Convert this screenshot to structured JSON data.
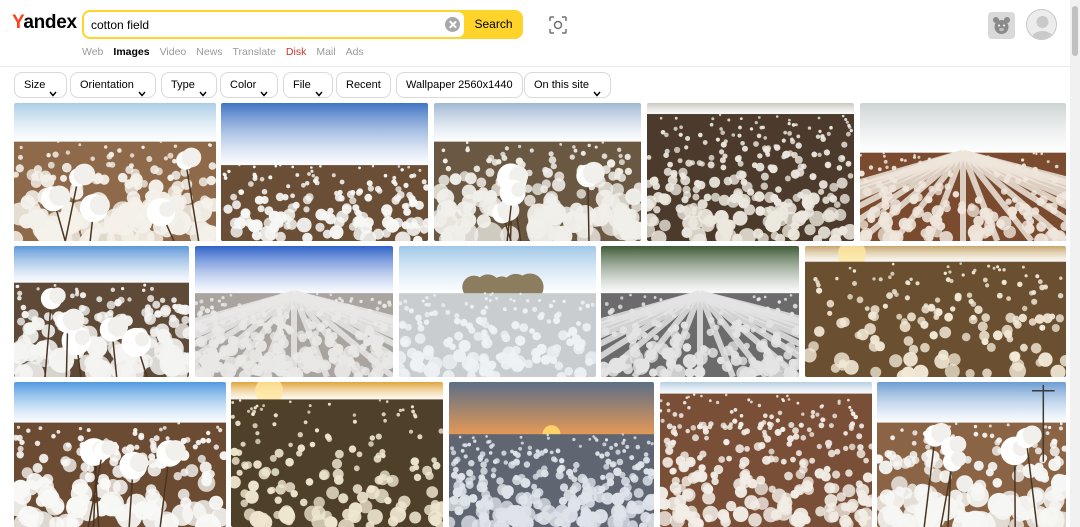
{
  "header": {
    "logo_y": "Y",
    "logo_rest": "andex",
    "search_value": "cotton field",
    "search_button": "Search",
    "services": [
      {
        "label": "Web",
        "state": "normal"
      },
      {
        "label": "Images",
        "state": "active"
      },
      {
        "label": "Video",
        "state": "normal"
      },
      {
        "label": "News",
        "state": "normal"
      },
      {
        "label": "Translate",
        "state": "normal"
      },
      {
        "label": "Disk",
        "state": "disk"
      },
      {
        "label": "Mail",
        "state": "normal"
      },
      {
        "label": "Ads",
        "state": "normal"
      }
    ],
    "icons": {
      "camera": "camera-search-icon",
      "bear": "bear-icon",
      "avatar": "avatar-icon",
      "clear": "clear-icon"
    }
  },
  "filters": [
    {
      "label": "Size",
      "dropdown": true
    },
    {
      "label": "Orientation",
      "dropdown": true
    },
    {
      "label": "Type",
      "dropdown": true
    },
    {
      "label": "Color",
      "dropdown": true
    },
    {
      "label": "File",
      "dropdown": true
    },
    {
      "label": "Recent",
      "dropdown": false
    },
    {
      "label": "Wallpaper 2560x1440",
      "dropdown": false
    },
    {
      "label": "On this site",
      "dropdown": true
    }
  ],
  "colors": {
    "accent": "#fed42b",
    "logo_red": "#fc3f1d",
    "disk_red": "#c8352e"
  },
  "images": [
    {
      "name": "cotton-closeup-blue-sky",
      "sky": "#aacde6",
      "ground": "#8f6a4a",
      "cotton": "#f4f1ea",
      "style": "closeup"
    },
    {
      "name": "cotton-rows-bright-sky",
      "sky": "#3f74c4",
      "ground": "#6a4f36",
      "cotton": "#f7f7f5",
      "style": "diagonal"
    },
    {
      "name": "cotton-bolls-pale-sky",
      "sky": "#9fb8d2",
      "ground": "#6b5842",
      "cotton": "#f1efea",
      "style": "closeup"
    },
    {
      "name": "cotton-dense-field",
      "sky": "#c9c7c2",
      "ground": "#4c3b2c",
      "cotton": "#ece8df",
      "style": "dense"
    },
    {
      "name": "cotton-row-hazy",
      "sky": "#cdd3d4",
      "ground": "#7a4b2f",
      "cotton": "#efe6dc",
      "style": "perspective"
    },
    {
      "name": "cotton-branch-cloudy",
      "sky": "#5d97d8",
      "ground": "#5e4a36",
      "cotton": "#f4f4f2",
      "style": "closeup"
    },
    {
      "name": "cotton-rows-clear-sky",
      "sky": "#2f63c9",
      "ground": "#a9a4a0",
      "cotton": "#e9e8e6",
      "style": "rows"
    },
    {
      "name": "cotton-trees-horizon",
      "sky": "#9fc7e8",
      "ground": "#c9cdd0",
      "cotton": "#eef2f4",
      "style": "trees"
    },
    {
      "name": "cotton-rows-tree-line",
      "sky": "#3e5a36",
      "ground": "#6b6b6b",
      "cotton": "#e4e4e4",
      "style": "perspective"
    },
    {
      "name": "cotton-golden-rows",
      "sky": "#c7a66c",
      "ground": "#6a5030",
      "cotton": "#f1e8d6",
      "style": "golden"
    },
    {
      "name": "cotton-boll-blue-sky",
      "sky": "#4f9ae0",
      "ground": "#6c4b33",
      "cotton": "#f8f8f6",
      "style": "closeup"
    },
    {
      "name": "cotton-sunset-closeup",
      "sky": "#e1a43b",
      "ground": "#4e4029",
      "cotton": "#efe6d0",
      "style": "golden"
    },
    {
      "name": "cotton-sunset-horizon",
      "sky": "#5d6f86",
      "ground": "#5f6672",
      "cotton": "#dfe3ea",
      "style": "sunset"
    },
    {
      "name": "cotton-evening-field",
      "sky": "#b5cee3",
      "ground": "#7a4f38",
      "cotton": "#f2ede6",
      "style": "dense"
    },
    {
      "name": "cotton-power-pole",
      "sky": "#6d9dd2",
      "ground": "#8a6445",
      "cotton": "#f6f6f4",
      "style": "closeup"
    }
  ]
}
